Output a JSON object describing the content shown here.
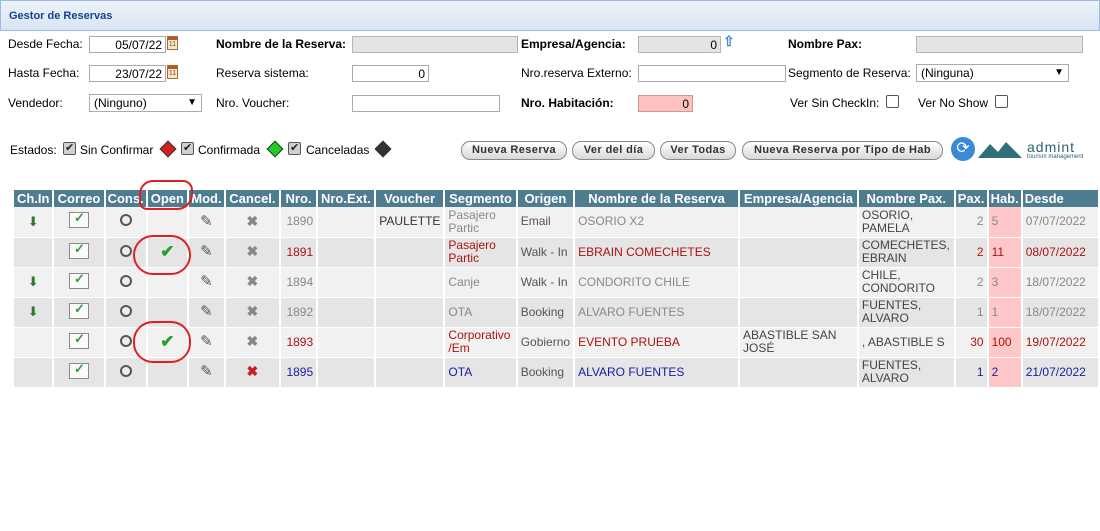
{
  "panel": {
    "title": "Gestor de Reservas"
  },
  "filters": {
    "desde_fecha_label": "Desde Fecha:",
    "desde_fecha_value": "05/07/22",
    "hasta_fecha_label": "Hasta Fecha:",
    "hasta_fecha_value": "23/07/22",
    "vendedor_label": "Vendedor:",
    "vendedor_value": "(Ninguno)",
    "nombre_reserva_label": "Nombre de la Reserva:",
    "nombre_reserva_value": "",
    "reserva_sistema_label": "Reserva sistema:",
    "reserva_sistema_value": "0",
    "nro_voucher_label": "Nro. Voucher:",
    "nro_voucher_value": "",
    "empresa_label": "Empresa/Agencia:",
    "empresa_value": "0",
    "nro_externo_label": "Nro.reserva Externo:",
    "nro_externo_value": "",
    "nro_habitacion_label": "Nro. Habitación:",
    "nro_habitacion_value": "0",
    "nombre_pax_label": "Nombre Pax:",
    "nombre_pax_value": "",
    "segmento_label": "Segmento de Reserva:",
    "segmento_value": "(Ninguna)",
    "ver_sin_checkin_label": "Ver Sin CheckIn:",
    "ver_no_show_label": "Ver No Show"
  },
  "estados": {
    "label": "Estados:",
    "sin_confirmar": "Sin Confirmar",
    "confirmada": "Confirmada",
    "canceladas": "Canceladas",
    "colors": {
      "sin_confirmar": "#d42020",
      "confirmada": "#22cc22",
      "canceladas": "#333333"
    }
  },
  "buttons": {
    "nueva_reserva": "Nueva Reserva",
    "ver_del_dia": "Ver del día",
    "ver_todas": "Ver Todas",
    "nueva_por_tipo": "Nueva Reserva por Tipo de Hab"
  },
  "logo": {
    "text": "admint",
    "subtext": "tourism management"
  },
  "table": {
    "columns": [
      "Ch.In",
      "Correo",
      "Cons.",
      "Open",
      "Mod.",
      "Cancel.",
      "Nro.",
      "Nro.Ext.",
      "Voucher",
      "Segmento",
      "Origen",
      "Nombre de la Reserva",
      "Empresa/Agencia",
      "Nombre Pax.",
      "Pax.",
      "Hab.",
      "Desde"
    ],
    "rows": [
      {
        "checkin": true,
        "open": false,
        "cancel_active": false,
        "color": "#888888",
        "nro": "1890",
        "nro_ext": "",
        "voucher": "PAULETTE",
        "segmento": "Pasajero Partic",
        "origen": "Email",
        "nombre": "OSORIO X2",
        "empresa": "",
        "pax_name": " OSORIO, PAMELA",
        "pax": "2",
        "hab": "5",
        "desde": "07/07/2022"
      },
      {
        "checkin": false,
        "open": true,
        "cancel_active": false,
        "color": "#b01010",
        "nro": "1891",
        "nro_ext": "",
        "voucher": "",
        "segmento": " Pasajero Partic",
        "origen": "Walk - In",
        "nombre": "EBRAIN COMECHETES",
        "empresa": "",
        "pax_name": " COMECHETES, EBRAIN",
        "pax": "2",
        "hab": "11",
        "desde": "08/07/2022"
      },
      {
        "checkin": true,
        "open": false,
        "cancel_active": false,
        "color": "#888888",
        "nro": "1894",
        "nro_ext": "",
        "voucher": "",
        "segmento": "Canje",
        "origen": "Walk - In",
        "nombre": "CONDORITO CHILE",
        "empresa": "",
        "pax_name": " CHILE, CONDORITO",
        "pax": "2",
        "hab": "3",
        "desde": "18/07/2022"
      },
      {
        "checkin": true,
        "open": false,
        "cancel_active": false,
        "color": "#888888",
        "nro": "1892",
        "nro_ext": "",
        "voucher": "",
        "segmento": "OTA",
        "origen": "Booking",
        "nombre": "ALVARO FUENTES",
        "empresa": "",
        "pax_name": " FUENTES, ALVARO",
        "pax": "1",
        "hab": "1",
        "desde": "18/07/2022"
      },
      {
        "checkin": false,
        "open": true,
        "cancel_active": false,
        "color": "#b01010",
        "nro": "1893",
        "nro_ext": "",
        "voucher": "",
        "segmento": " Corporativo /Em",
        "origen": "Gobierno",
        "nombre": "EVENTO PRUEBA",
        "empresa": " ABASTIBLE SAN JOSÉ",
        "pax_name": " , ABASTIBLE S",
        "pax": "30",
        "hab": "100",
        "desde": "19/07/2022"
      },
      {
        "checkin": false,
        "open": false,
        "cancel_active": true,
        "color": "#1a1aa8",
        "nro": "1895",
        "nro_ext": "",
        "voucher": "",
        "segmento": "OTA",
        "origen": "Booking",
        "nombre": "ALVARO FUENTES",
        "empresa": "",
        "pax_name": " FUENTES, ALVARO",
        "pax": "1",
        "hab": "2",
        "desde": "21/07/2022"
      }
    ]
  }
}
